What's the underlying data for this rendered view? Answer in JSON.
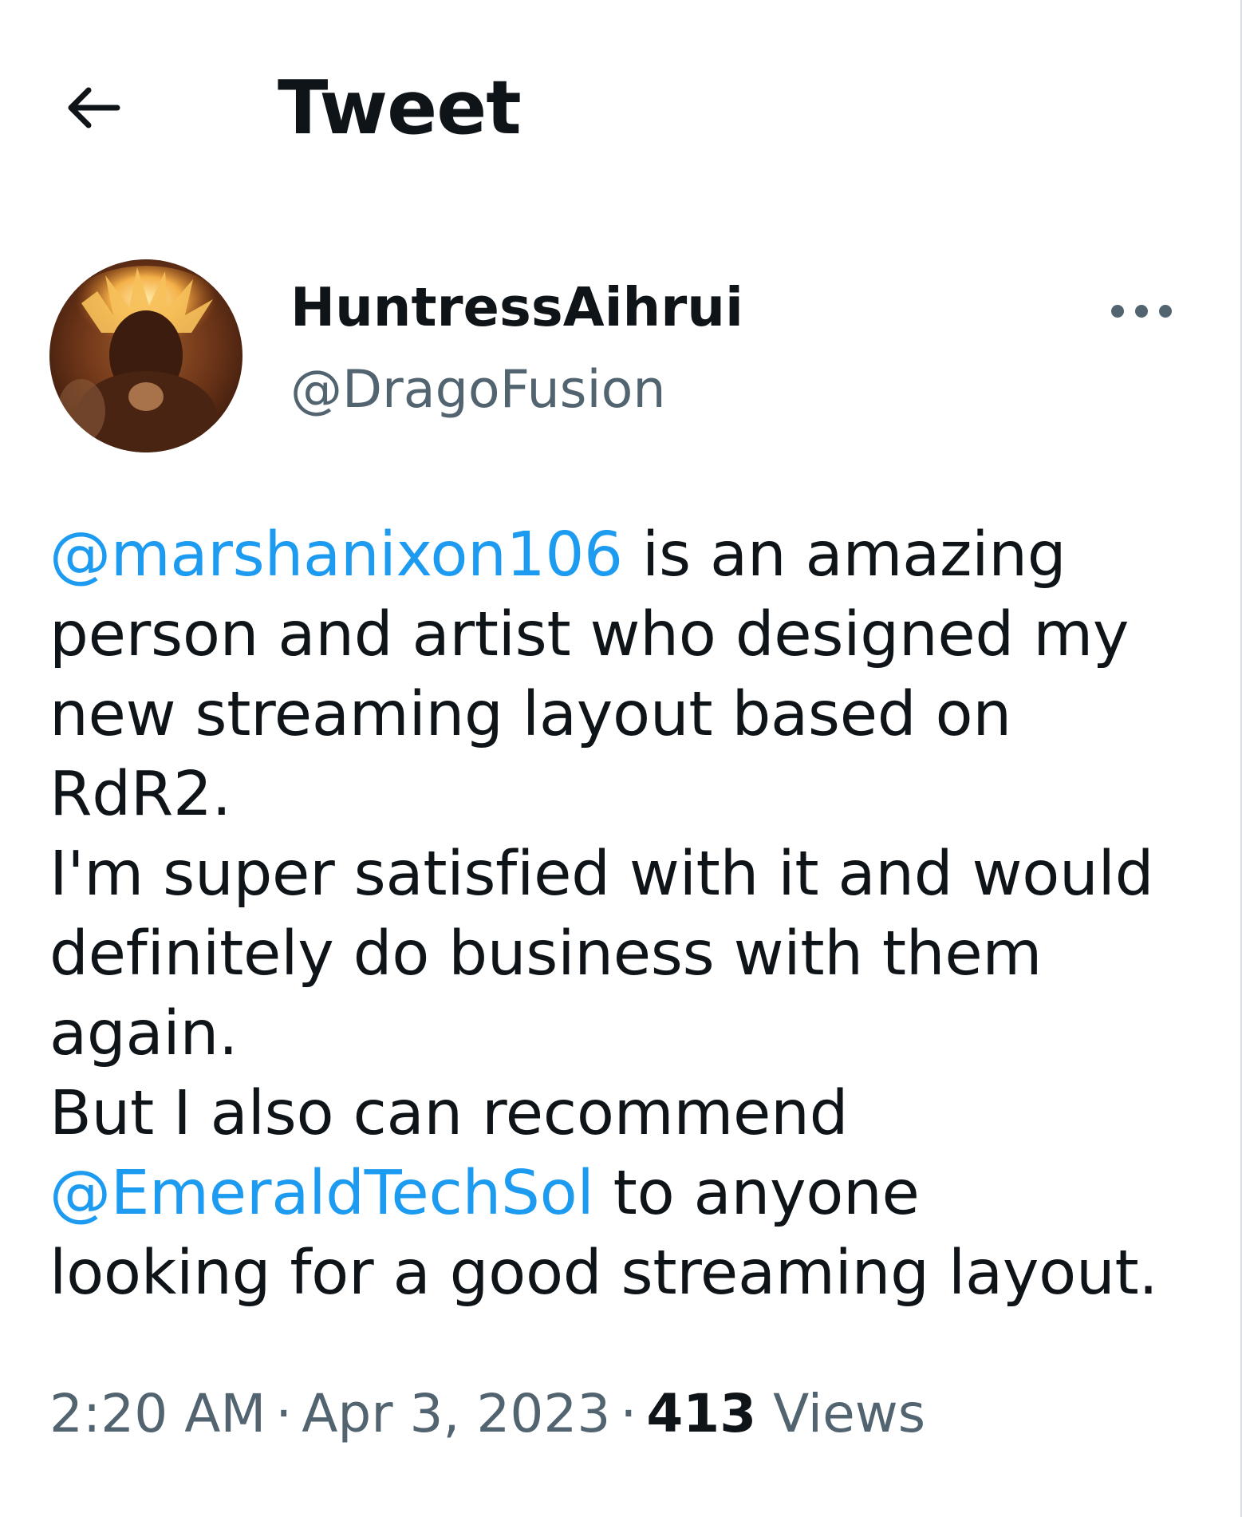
{
  "header": {
    "title": "Tweet"
  },
  "author": {
    "display_name": "HuntressAihrui",
    "handle": "@DragoFusion"
  },
  "tweet": {
    "lines": [
      [
        {
          "t": "@marshanixon106",
          "m": true
        },
        {
          "t": " is an amazing",
          "m": false
        }
      ],
      [
        {
          "t": "person and artist who designed my",
          "m": false
        }
      ],
      [
        {
          "t": "new streaming layout based on",
          "m": false
        }
      ],
      [
        {
          "t": "RdR2.",
          "m": false
        }
      ],
      [
        {
          "t": "I'm super satisfied with it and would",
          "m": false
        }
      ],
      [
        {
          "t": "definitely do business with them",
          "m": false
        }
      ],
      [
        {
          "t": "again.",
          "m": false
        }
      ],
      [
        {
          "t": "But I also can recommend",
          "m": false
        }
      ],
      [
        {
          "t": "@EmeraldTechSol",
          "m": true
        },
        {
          "t": " to anyone",
          "m": false
        }
      ],
      [
        {
          "t": "looking for a good streaming layout.",
          "m": false
        }
      ]
    ]
  },
  "meta": {
    "time": "2:20 AM",
    "separator": "·",
    "date": "Apr 3, 2023",
    "views_count": "413",
    "views_label": "Views"
  },
  "colors": {
    "text_primary": "#0f1419",
    "text_secondary": "#536471",
    "mention": "#1d9bf0",
    "background": "#ffffff"
  },
  "icons": {
    "back": "arrow-left-icon",
    "more": "more-horizontal-icon"
  }
}
